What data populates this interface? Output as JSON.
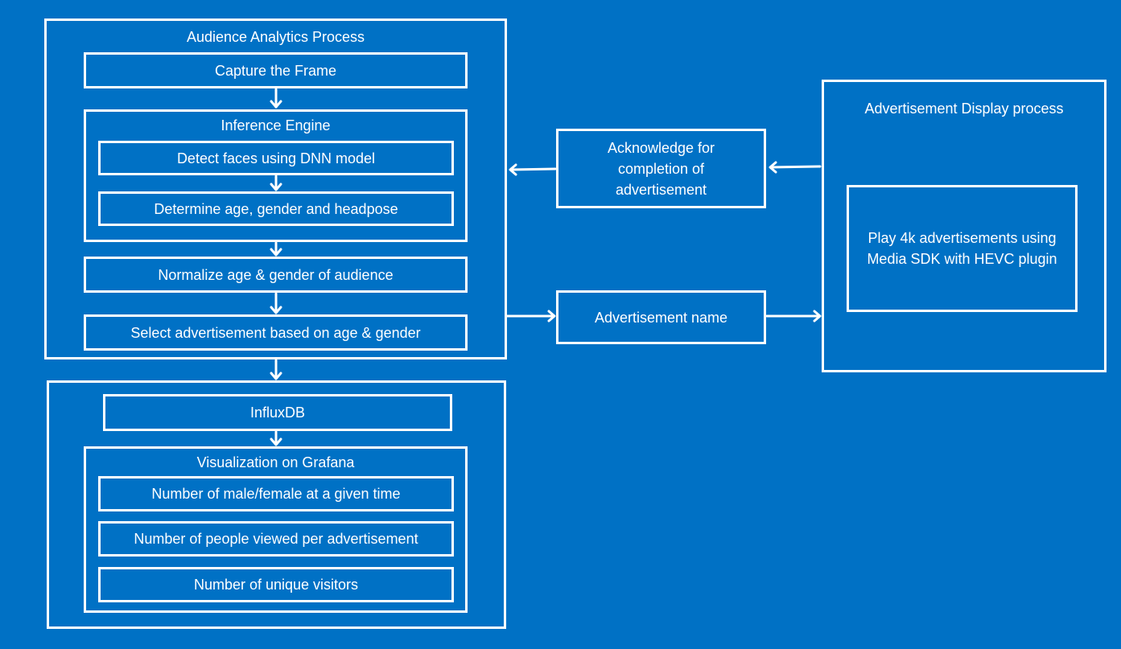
{
  "colors": {
    "background": "#0071C5",
    "stroke": "#FFFFFF"
  },
  "audience_analytics": {
    "title": "Audience Analytics Process",
    "capture": "Capture the Frame",
    "inference_engine": {
      "title": "Inference Engine",
      "steps": [
        "Detect faces using DNN model",
        "Determine age, gender and headpose"
      ]
    },
    "normalize": "Normalize age & gender of audience",
    "select": "Select advertisement based on age & gender"
  },
  "storage": {
    "influxdb": "InfluxDB",
    "grafana": {
      "title": "Visualization on Grafana",
      "items": [
        "Number of male/female at a given time",
        "Number of people viewed per advertisement",
        "Number of unique visitors"
      ]
    }
  },
  "messages": {
    "acknowledge": "Acknowledge for completion of advertisement",
    "ad_name": "Advertisement name"
  },
  "ad_display": {
    "title": "Advertisement Display process",
    "play": "Play 4k advertisements using Media SDK with HEVC plugin"
  }
}
